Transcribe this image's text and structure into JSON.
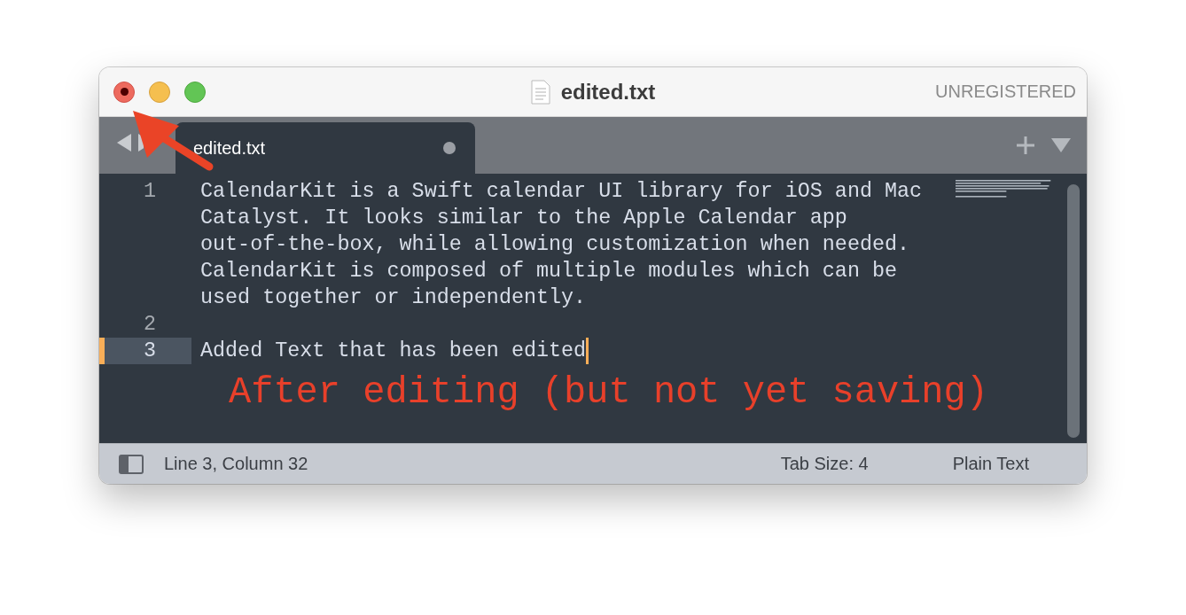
{
  "window": {
    "title": "edited.txt",
    "license": "UNREGISTERED",
    "close_hovered": true
  },
  "tabs": [
    {
      "label": "edited.txt",
      "selected": true,
      "modified": true
    }
  ],
  "editor": {
    "lines": [
      {
        "number": "1",
        "current": false,
        "modified": false,
        "caret": false,
        "rows": [
          "CalendarKit is a Swift calendar UI library for iOS and Mac",
          "Catalyst. It looks similar to the Apple Calendar app",
          "out-of-the-box, while allowing customization when needed.",
          "CalendarKit is composed of multiple modules which can be",
          "used together or independently."
        ]
      },
      {
        "number": "2",
        "current": false,
        "modified": false,
        "caret": false
      },
      {
        "number": "3",
        "current": true,
        "modified": true,
        "caret": true,
        "rows": [
          "Added Text that has been edited"
        ]
      }
    ]
  },
  "annotation": {
    "text": "After editing (but not yet saving)"
  },
  "status_bar": {
    "position": "Line 3, Column 32",
    "tab_size": "Tab Size: 4",
    "syntax": "Plain Text"
  }
}
